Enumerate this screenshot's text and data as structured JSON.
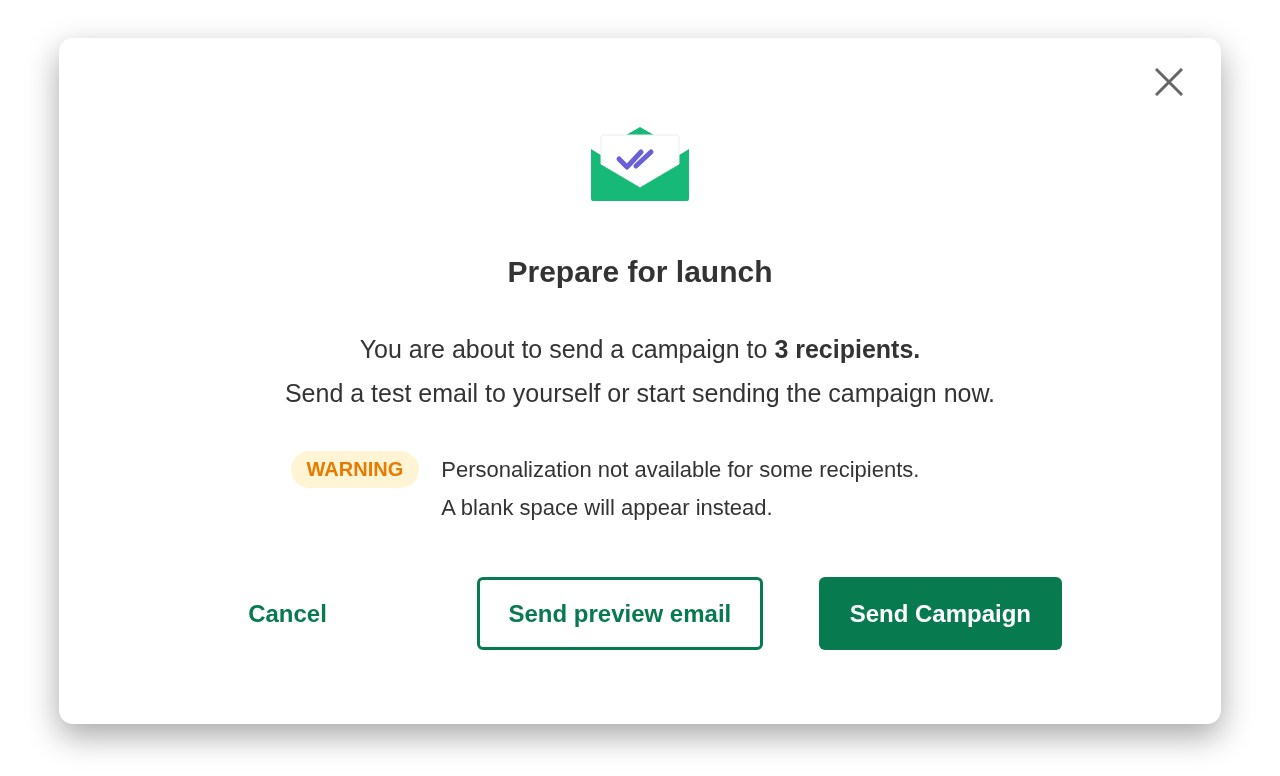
{
  "dialog": {
    "title": "Prepare for launch",
    "message_lines": [
      "You are about to send a campaign to **3 recipients.**",
      "Send a test email to yourself or start sending the campaign now."
    ],
    "warning": {
      "badge": "WARNING",
      "lines": [
        "Personalization not available for some recipients.",
        "A blank space will appear instead."
      ]
    },
    "buttons": [
      {
        "kind": "text",
        "label": "Cancel"
      },
      {
        "kind": "outline",
        "label": "Send preview email"
      },
      {
        "kind": "primary",
        "label": "Send Campaign"
      }
    ]
  }
}
